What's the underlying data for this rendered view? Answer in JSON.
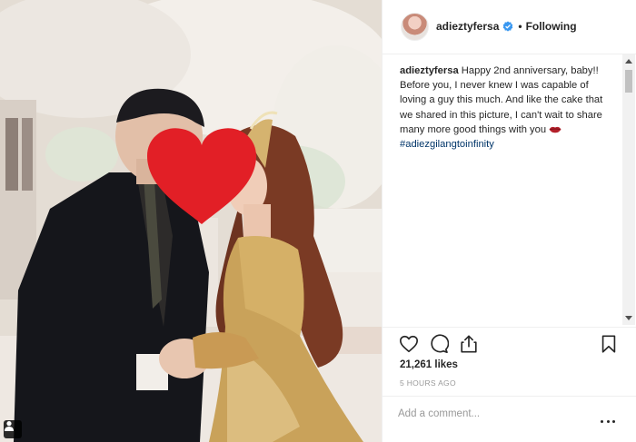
{
  "header": {
    "username": "adieztyfersa",
    "separator": "•",
    "follow_status": "Following"
  },
  "caption": {
    "username": "adieztyfersa",
    "text": "Happy 2nd anniversary, baby!! Before you, I never knew I was capable of loving a guy this much. And like the cake that we shared in this picture, I can't wait to share many more good things with you",
    "emoji_icon": "lips-icon",
    "hashtag": "#adiezgilangtoinfinity"
  },
  "actions": {
    "icons": [
      "heart-outline-icon",
      "comment-icon",
      "share-icon",
      "bookmark-icon"
    ]
  },
  "likes": "21,261 likes",
  "timestamp": "5 HOURS AGO",
  "comment": {
    "placeholder": "Add a comment..."
  },
  "colors": {
    "verified": "#3897f0",
    "hashtag": "#003569",
    "heart_sticker": "#e21f26",
    "border": "#efefef"
  }
}
